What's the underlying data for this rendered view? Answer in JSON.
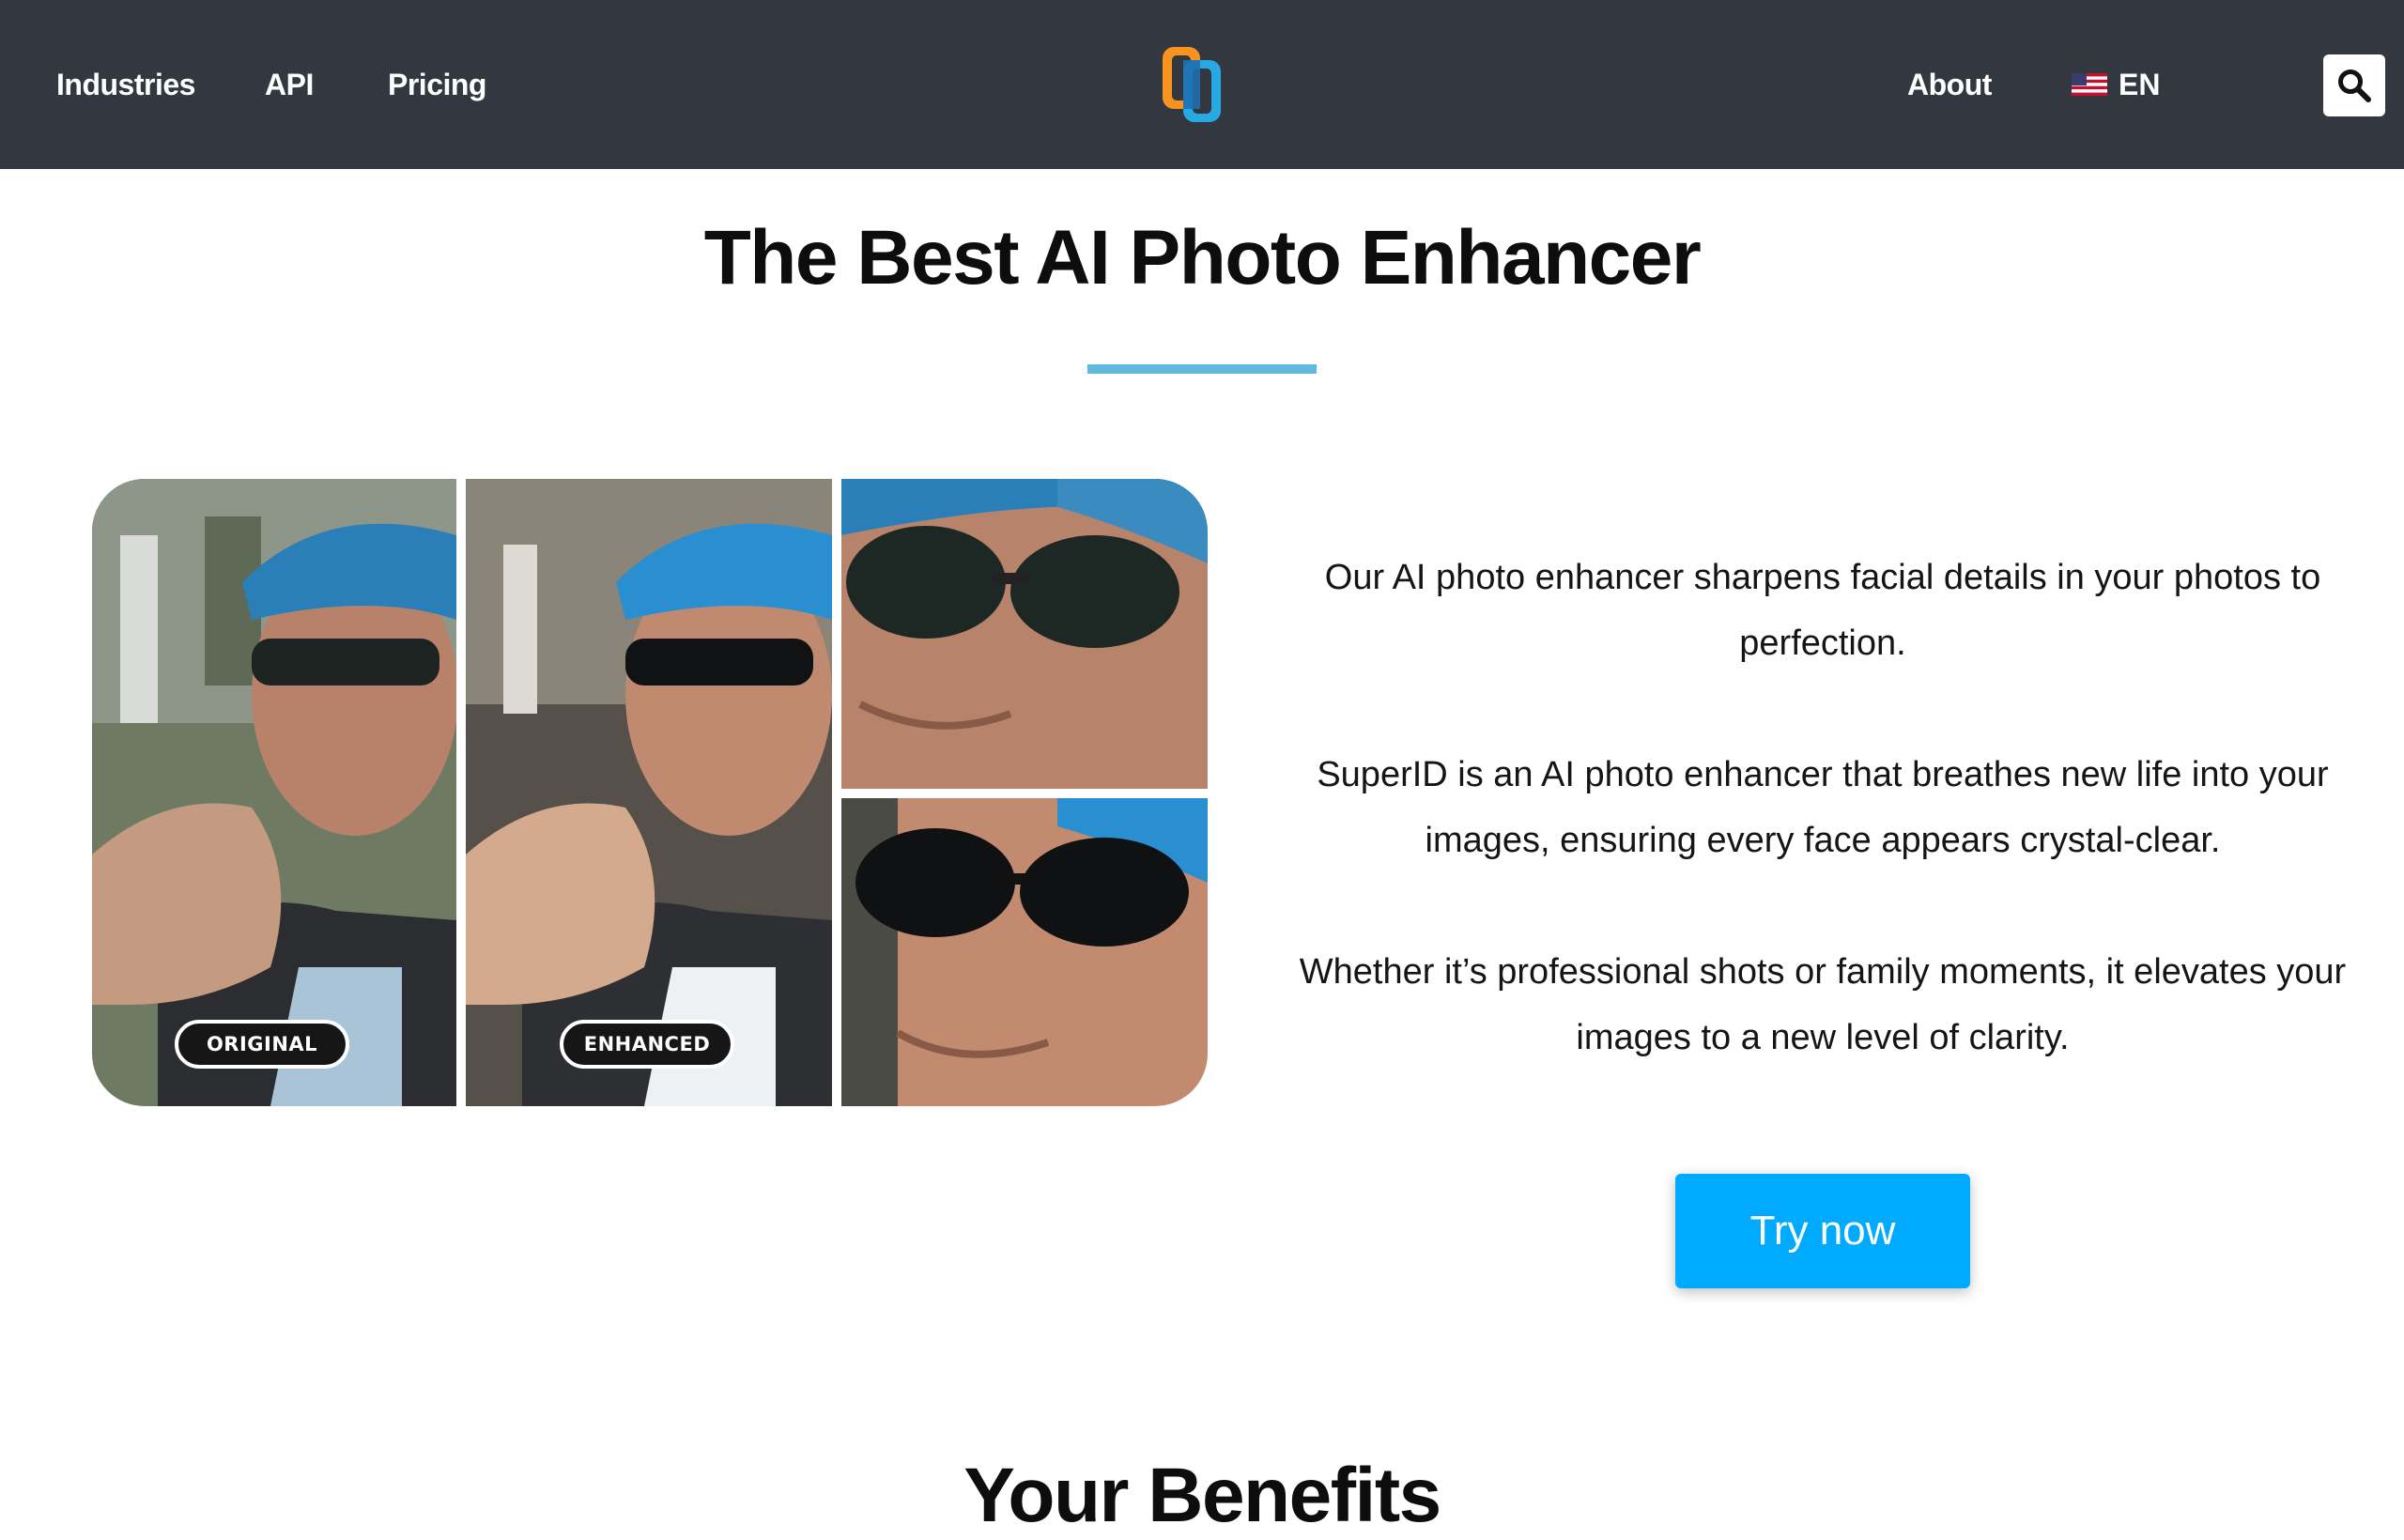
{
  "header": {
    "nav_left": [
      {
        "label": "Industries"
      },
      {
        "label": "API"
      },
      {
        "label": "Pricing"
      }
    ],
    "nav_right": {
      "about_label": "About"
    },
    "language": {
      "code": "EN",
      "flag_icon": "us-flag-icon"
    },
    "search_icon": "search-icon",
    "logo_colors": {
      "orange": "#f7931e",
      "blue": "#29a9e1"
    },
    "background_color": "#33373f"
  },
  "hero": {
    "title": "The Best AI Photo Enhancer",
    "underline_color": "#5fb8de",
    "labels": {
      "original": "ORIGINAL",
      "enhanced": "ENHANCED"
    },
    "paragraphs": [
      "Our AI photo enhancer sharpens facial details in your photos to perfection.",
      "SuperID is an AI photo enhancer that breathes new life into your images, ensuring every face appears crystal-clear.",
      "Whether it’s professional shots or family moments, it elevates your images to a new level of clarity."
    ],
    "cta_label": "Try now",
    "cta_color": "#00aaff"
  },
  "section": {
    "benefits_title": "Your Benefits"
  }
}
